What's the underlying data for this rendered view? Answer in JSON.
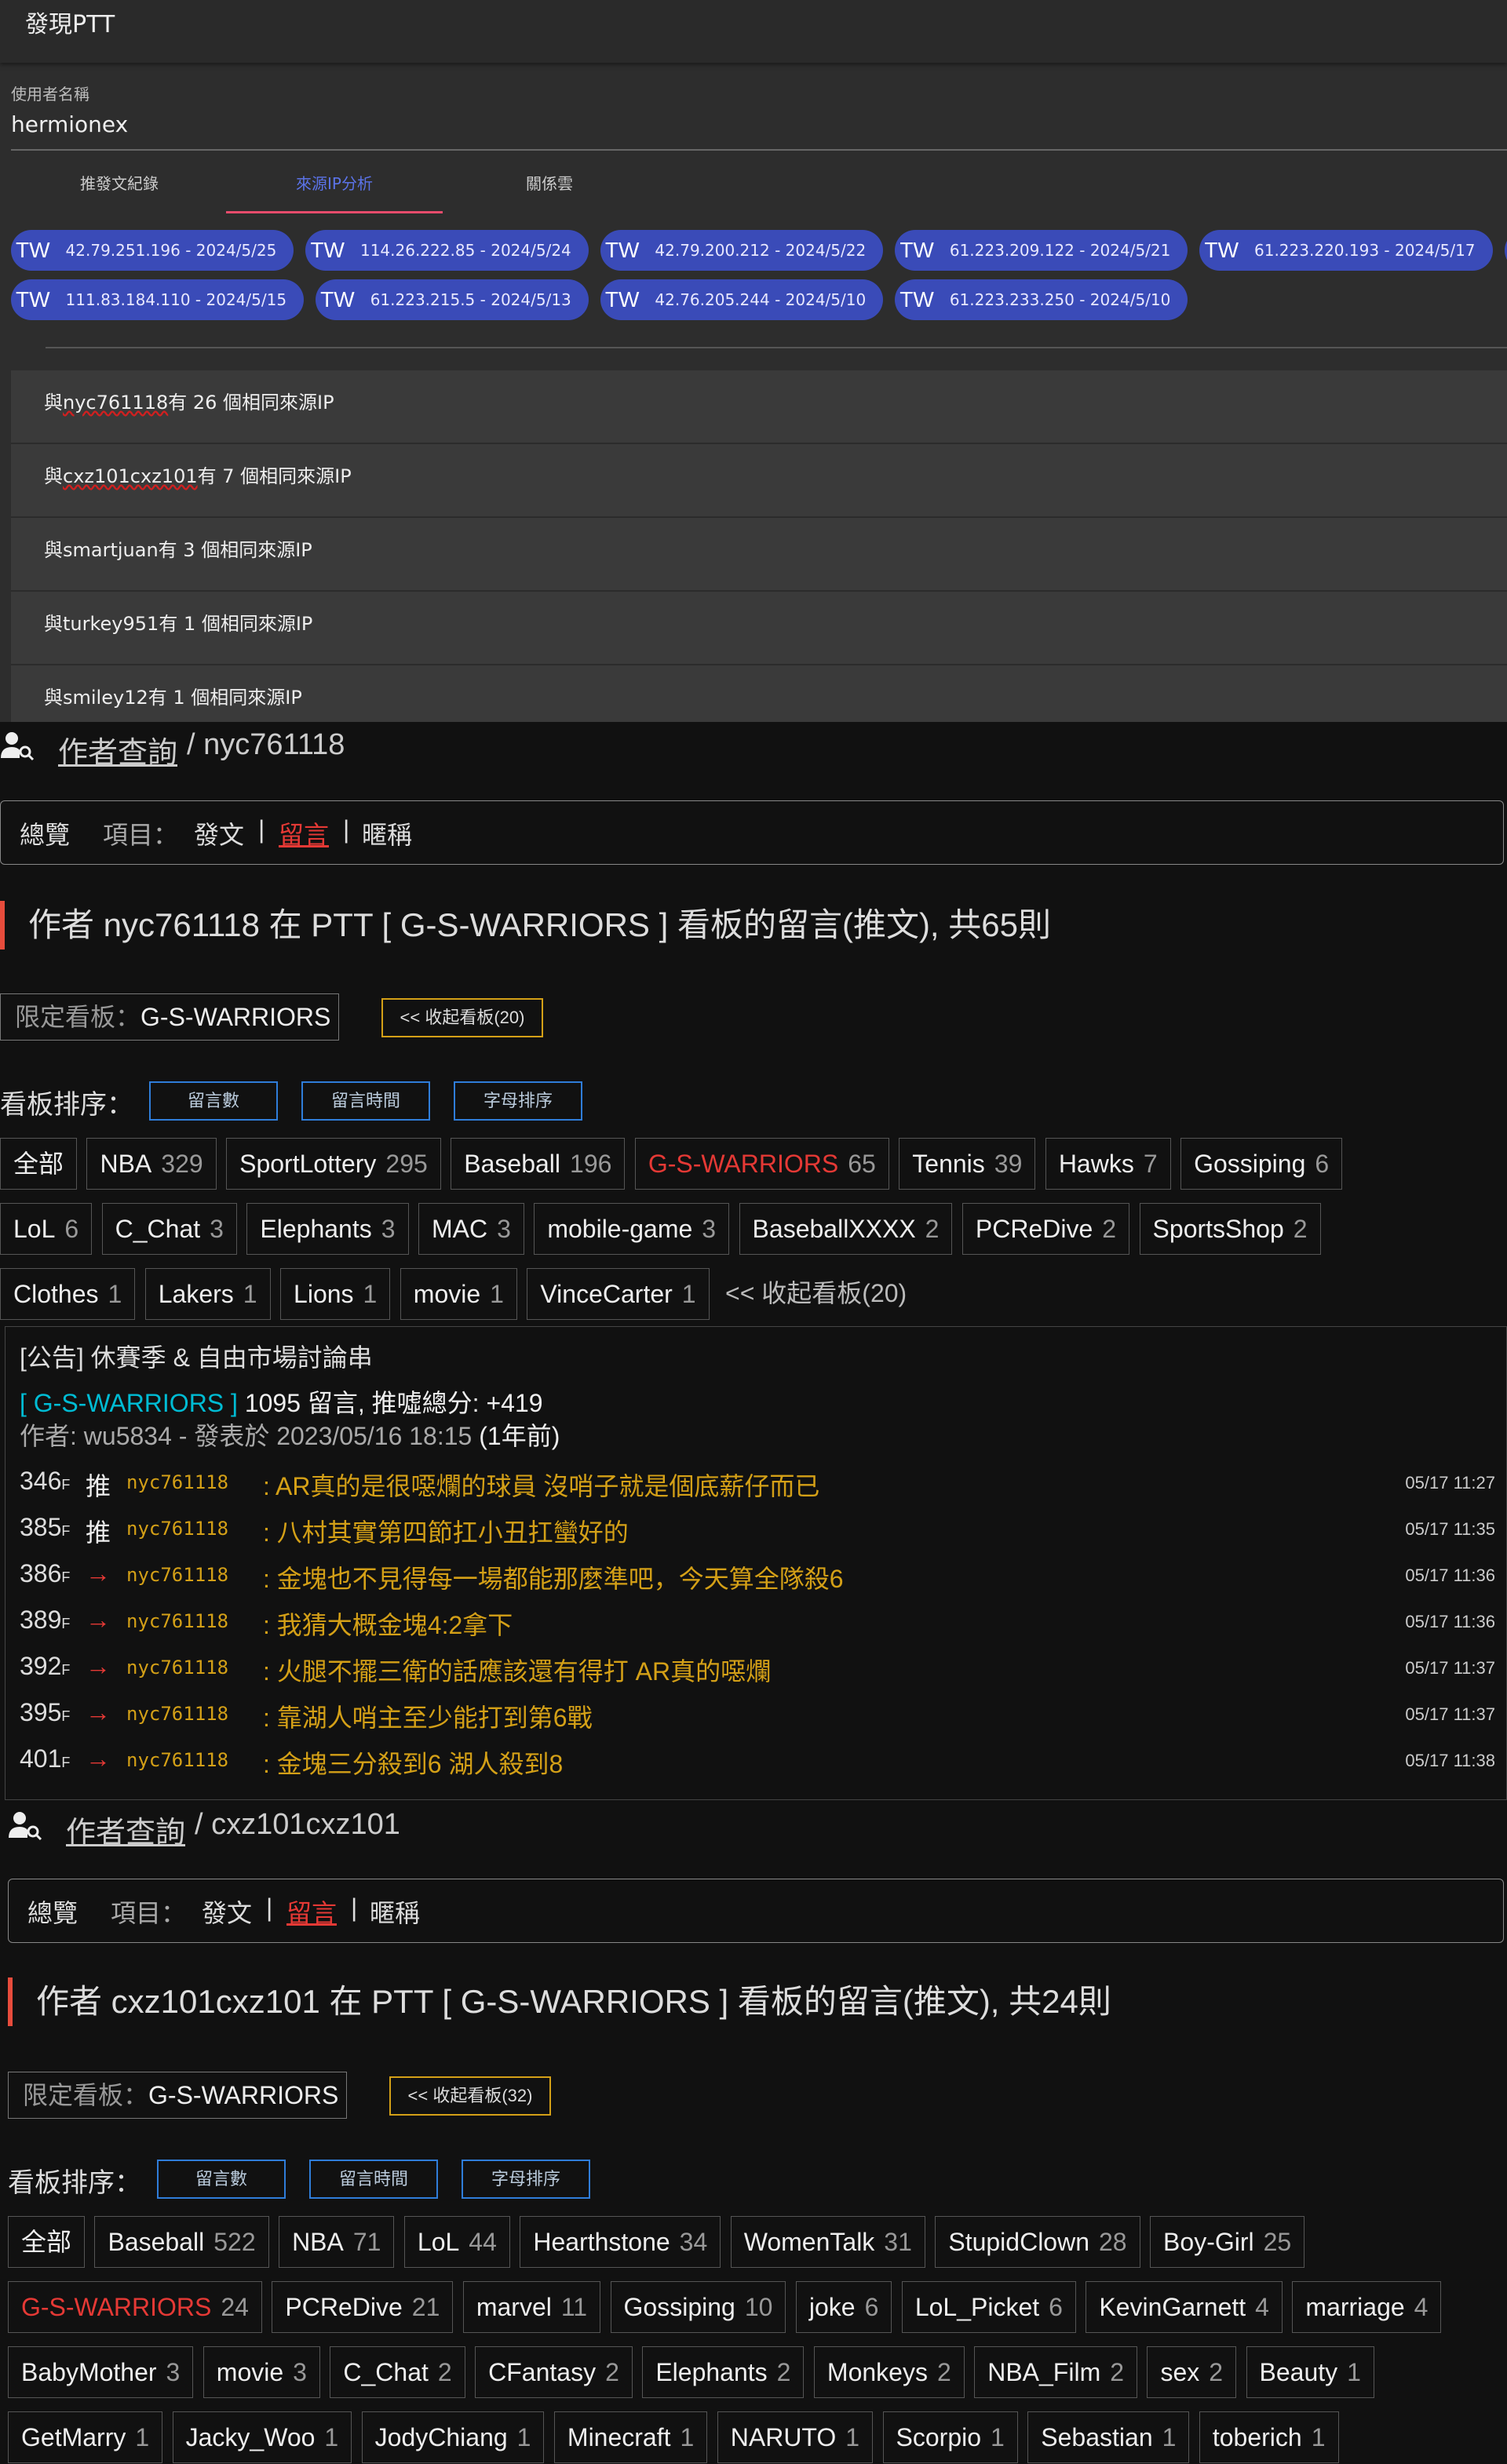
{
  "app": {
    "title": "發現PTT"
  },
  "user_field": {
    "label": "使用者名稱",
    "value": "hermionex"
  },
  "tabs": [
    {
      "label": "推發文紀錄"
    },
    {
      "label": "來源IP分析"
    },
    {
      "label": "關係雲"
    }
  ],
  "ip_chips_row1": [
    {
      "cc": "TW",
      "text": "42.79.251.196 - 2024/5/25"
    },
    {
      "cc": "TW",
      "text": "114.26.222.85 - 2024/5/24"
    },
    {
      "cc": "TW",
      "text": "42.79.200.212 - 2024/5/22"
    },
    {
      "cc": "TW",
      "text": "61.223.209.122 - 2024/5/21"
    },
    {
      "cc": "TW",
      "text": "61.223.220.193 - 2024/5/17"
    },
    {
      "cc": "TW",
      "text": ""
    }
  ],
  "ip_chips_row2": [
    {
      "cc": "TW",
      "text": "111.83.184.110 - 2024/5/15"
    },
    {
      "cc": "TW",
      "text": "61.223.215.5 - 2024/5/13"
    },
    {
      "cc": "TW",
      "text": "42.76.205.244 - 2024/5/10"
    },
    {
      "cc": "TW",
      "text": "61.223.233.250 - 2024/5/10"
    }
  ],
  "shared_ip": [
    {
      "pre": "與",
      "user": "nyc761118",
      "post": "有 26 個相同來源IP"
    },
    {
      "pre": "與",
      "user": "cxz101cxz101",
      "post": "有 7 個相同來源IP"
    },
    {
      "pre": "與",
      "user": "smartjuan",
      "post": "有 3 個相同來源IP"
    },
    {
      "pre": "與",
      "user": "turkey951",
      "post": "有 1 個相同來源IP"
    },
    {
      "pre": "與",
      "user": "smiley12",
      "post": "有 1 個相同來源IP"
    }
  ],
  "s1": {
    "link": "作者查詢",
    "rest": "/ nyc761118",
    "nav": {
      "overview": "總覽",
      "items": "項目：",
      "post": "發文",
      "sep": "|",
      "comment": "留言",
      "nick": "暱稱"
    },
    "title": "作者 nyc761118 在 PTT [ G-S-WARRIORS ] 看板的留言(推文), 共65則",
    "limit_label": "限定看板：",
    "limit_value": "G-S-WARRIORS",
    "collapse": "<< 收起看板(20)",
    "sort_label": "看板排序：",
    "sort_btns": [
      "留言數",
      "留言時間",
      "字母排序"
    ],
    "boards_row1": [
      {
        "name": "全部",
        "count": ""
      },
      {
        "name": "NBA",
        "count": "329"
      },
      {
        "name": "SportLottery",
        "count": "295"
      },
      {
        "name": "Baseball",
        "count": "196"
      },
      {
        "name": "G-S-WARRIORS",
        "count": "65"
      },
      {
        "name": "Tennis",
        "count": "39"
      },
      {
        "name": "Hawks",
        "count": "7"
      },
      {
        "name": "Gossiping",
        "count": "6"
      }
    ],
    "boards_row2": [
      {
        "name": "LoL",
        "count": "6"
      },
      {
        "name": "C_Chat",
        "count": "3"
      },
      {
        "name": "Elephants",
        "count": "3"
      },
      {
        "name": "MAC",
        "count": "3"
      },
      {
        "name": "mobile-game",
        "count": "3"
      },
      {
        "name": "BaseballXXXX",
        "count": "2"
      },
      {
        "name": "PCReDive",
        "count": "2"
      },
      {
        "name": "SportsShop",
        "count": "2"
      }
    ],
    "boards_row3": [
      {
        "name": "Clothes",
        "count": "1"
      },
      {
        "name": "Lakers",
        "count": "1"
      },
      {
        "name": "Lions",
        "count": "1"
      },
      {
        "name": "movie",
        "count": "1"
      },
      {
        "name": "VinceCarter",
        "count": "1"
      }
    ],
    "boards_collapse": "<< 收起看板(20)",
    "post": {
      "title": "[公告] 休賽季 & 自由市場討論串",
      "board": "[ G-S-WARRIORS ]",
      "stats_a": " 1095",
      "stats_b": " 留言, 推噓總分: ",
      "stats_c": "+419",
      "author": "作者: wu5834 - 發表於 2023/05/16 18:15",
      "ago": " (1年前)",
      "comments": [
        {
          "floor": "346",
          "f": "F",
          "tag": "推",
          "user": "nyc761118",
          "text": ": AR真的是很噁爛的球員 沒哨子就是個底薪仔而已",
          "time": "05/17 11:27"
        },
        {
          "floor": "385",
          "f": "F",
          "tag": "推",
          "user": "nyc761118",
          "text": ": 八村其實第四節扛小丑扛蠻好的",
          "time": "05/17 11:35"
        },
        {
          "floor": "386",
          "f": "F",
          "tag": "→",
          "user": "nyc761118",
          "text": ": 金塊也不見得每一場都能那麼準吧，今天算全隊殺6",
          "time": "05/17 11:36"
        },
        {
          "floor": "389",
          "f": "F",
          "tag": "→",
          "user": "nyc761118",
          "text": ": 我猜大概金塊4:2拿下",
          "time": "05/17 11:36"
        },
        {
          "floor": "392",
          "f": "F",
          "tag": "→",
          "user": "nyc761118",
          "text": ": 火腿不擺三衛的話應該還有得打 AR真的噁爛",
          "time": "05/17 11:37"
        },
        {
          "floor": "395",
          "f": "F",
          "tag": "→",
          "user": "nyc761118",
          "text": ": 靠湖人哨主至少能打到第6戰",
          "time": "05/17 11:37"
        },
        {
          "floor": "401",
          "f": "F",
          "tag": "→",
          "user": "nyc761118",
          "text": ": 金塊三分殺到6 湖人殺到8",
          "time": "05/17 11:38"
        }
      ]
    }
  },
  "s2": {
    "link": "作者查詢",
    "rest": "/ cxz101cxz101",
    "nav": {
      "overview": "總覽",
      "items": "項目：",
      "post": "發文",
      "sep": "|",
      "comment": "留言",
      "nick": "暱稱"
    },
    "title": "作者 cxz101cxz101 在 PTT [ G-S-WARRIORS ] 看板的留言(推文), 共24則",
    "limit_label": "限定看板：",
    "limit_value": "G-S-WARRIORS",
    "collapse": "<< 收起看板(32)",
    "sort_label": "看板排序：",
    "sort_btns": [
      "留言數",
      "留言時間",
      "字母排序"
    ],
    "boards_row1": [
      {
        "name": "全部",
        "count": ""
      },
      {
        "name": "Baseball",
        "count": "522"
      },
      {
        "name": "NBA",
        "count": "71"
      },
      {
        "name": "LoL",
        "count": "44"
      },
      {
        "name": "Hearthstone",
        "count": "34"
      },
      {
        "name": "WomenTalk",
        "count": "31"
      },
      {
        "name": "StupidClown",
        "count": "28"
      },
      {
        "name": "Boy-Girl",
        "count": "25"
      }
    ],
    "boards_row2": [
      {
        "name": "G-S-WARRIORS",
        "count": "24"
      },
      {
        "name": "PCReDive",
        "count": "21"
      },
      {
        "name": "marvel",
        "count": "11"
      },
      {
        "name": "Gossiping",
        "count": "10"
      },
      {
        "name": "joke",
        "count": "6"
      },
      {
        "name": "LoL_Picket",
        "count": "6"
      },
      {
        "name": "KevinGarnett",
        "count": "4"
      },
      {
        "name": "marriage",
        "count": "4"
      }
    ],
    "boards_row3": [
      {
        "name": "BabyMother",
        "count": "3"
      },
      {
        "name": "movie",
        "count": "3"
      },
      {
        "name": "C_Chat",
        "count": "2"
      },
      {
        "name": "CFantasy",
        "count": "2"
      },
      {
        "name": "Elephants",
        "count": "2"
      },
      {
        "name": "Monkeys",
        "count": "2"
      },
      {
        "name": "NBA_Film",
        "count": "2"
      },
      {
        "name": "sex",
        "count": "2"
      },
      {
        "name": "Beauty",
        "count": "1"
      }
    ],
    "boards_row4": [
      {
        "name": "GetMarry",
        "count": "1"
      },
      {
        "name": "Jacky_Woo",
        "count": "1"
      },
      {
        "name": "JodyChiang",
        "count": "1"
      },
      {
        "name": "Minecraft",
        "count": "1"
      },
      {
        "name": "NARUTO",
        "count": "1"
      },
      {
        "name": "Scorpio",
        "count": "1"
      },
      {
        "name": "Sebastian",
        "count": "1"
      },
      {
        "name": "toberich",
        "count": "1"
      }
    ]
  },
  "colors": {
    "tab_accent": "#5b73e8",
    "tab_underline": "#e74c6c",
    "chip_bg": "#3a4bb8",
    "title_bar": "#e74c3c",
    "active_red": "#e53935",
    "board_cyan": "#00bcd4",
    "comment_gold": "#d4a017",
    "sort_blue": "#2f7dd9"
  },
  "icons": {
    "author_search": "person-search-icon"
  }
}
